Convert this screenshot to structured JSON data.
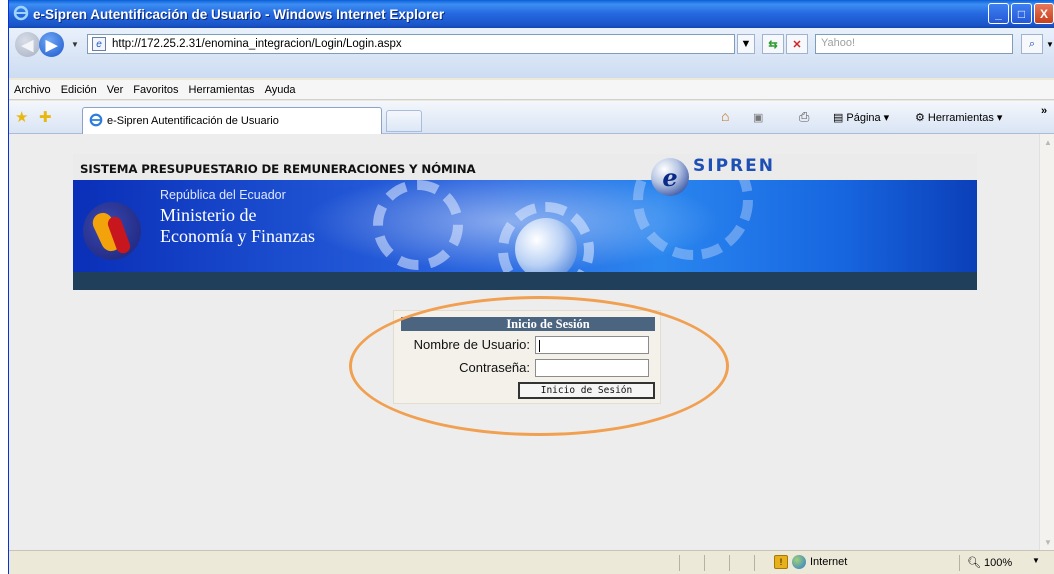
{
  "window": {
    "title": "e-Sipren Autentificación de Usuario - Windows Internet Explorer",
    "buttons": [
      "_",
      "□",
      "X"
    ]
  },
  "addressbar": {
    "url": "http://172.25.2.31/enomina_integracion/Login/Login.aspx",
    "search_placeholder": "Yahoo!"
  },
  "menu": {
    "items": [
      "Archivo",
      "Edición",
      "Ver",
      "Favoritos",
      "Herramientas",
      "Ayuda"
    ]
  },
  "tabs": {
    "active_tab_label": "e-Sipren Autentificación de Usuario"
  },
  "toolbar": {
    "page_label": "Página",
    "tools_label": "Herramientas",
    "more": "»"
  },
  "banner": {
    "system_title": "SISTEMA PRESUPUESTARIO DE REMUNERACIONES Y NÓMINA",
    "brand": "SIPREN",
    "brand_e": "e",
    "republic": "República del Ecuador",
    "ministry_line1": "Ministerio de",
    "ministry_line2": "Economía y Finanzas"
  },
  "login": {
    "header": "Inicio de Sesión",
    "username_label": "Nombre de Usuario:",
    "password_label": "Contraseña:",
    "username_value": "",
    "password_value": "",
    "submit_label": "Inicio de Sesión"
  },
  "statusbar": {
    "zone": "Internet",
    "zoom": "100%"
  },
  "colors": {
    "highlight_ring": "#f0a050",
    "login_header": "#4b6480",
    "banner_bar": "#1f3f5a"
  }
}
